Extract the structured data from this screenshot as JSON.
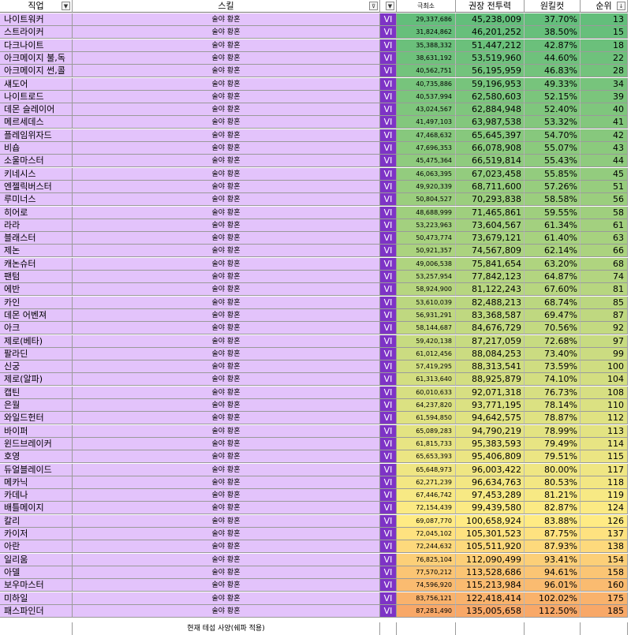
{
  "header": {
    "job": "직업",
    "skill": "스킬",
    "v": "",
    "min": "극최소",
    "cp": "권장 전투력",
    "pct": "원킬컷",
    "rank": "순위",
    "filter_icon": "dropdown-filter-icon",
    "sort_icon": "sort-filter-icon"
  },
  "colors": {
    "job_bg": "#e3c3fb",
    "v_bg": "#7e33c6",
    "gradient_low": "#63be7b",
    "gradient_mid": "#ffeb84",
    "gradient_high": "#f8a868"
  },
  "rows": [
    {
      "job": "나이트워커",
      "skill": "술야 황혼",
      "v": "VI",
      "min": "29,337,686",
      "cp": "45,238,009",
      "pct": "37.70%",
      "rank": "13"
    },
    {
      "job": "스트라이커",
      "skill": "술야 황혼",
      "v": "VI",
      "min": "31,824,862",
      "cp": "46,201,252",
      "pct": "38.50%",
      "rank": "15"
    },
    {
      "job": "다크나이트",
      "skill": "술야 황혼",
      "v": "VI",
      "min": "35,388,332",
      "cp": "51,447,212",
      "pct": "42.87%",
      "rank": "18"
    },
    {
      "job": "아크메이지 불,독",
      "skill": "술야 황혼",
      "v": "VI",
      "min": "38,631,192",
      "cp": "53,519,960",
      "pct": "44.60%",
      "rank": "22"
    },
    {
      "job": "아크메이지 썬,콜",
      "skill": "술야 황혼",
      "v": "VI",
      "min": "40,562,751",
      "cp": "56,195,959",
      "pct": "46.83%",
      "rank": "28"
    },
    {
      "job": "섀도어",
      "skill": "술야 황혼",
      "v": "VI",
      "min": "40,735,886",
      "cp": "59,196,953",
      "pct": "49.33%",
      "rank": "34"
    },
    {
      "job": "나이트로드",
      "skill": "술야 황혼",
      "v": "VI",
      "min": "40,537,994",
      "cp": "62,580,603",
      "pct": "52.15%",
      "rank": "39"
    },
    {
      "job": "데몬 슬레이어",
      "skill": "술야 황혼",
      "v": "VI",
      "min": "43,024,567",
      "cp": "62,884,948",
      "pct": "52.40%",
      "rank": "40"
    },
    {
      "job": "메르세데스",
      "skill": "술야 황혼",
      "v": "VI",
      "min": "41,497,103",
      "cp": "63,987,538",
      "pct": "53.32%",
      "rank": "41"
    },
    {
      "job": "플레임위자드",
      "skill": "술야 황혼",
      "v": "VI",
      "min": "47,468,632",
      "cp": "65,645,397",
      "pct": "54.70%",
      "rank": "42"
    },
    {
      "job": "비숍",
      "skill": "술야 황혼",
      "v": "VI",
      "min": "47,696,353",
      "cp": "66,078,908",
      "pct": "55.07%",
      "rank": "43"
    },
    {
      "job": "소울마스터",
      "skill": "술야 황혼",
      "v": "VI",
      "min": "45,475,364",
      "cp": "66,519,814",
      "pct": "55.43%",
      "rank": "44"
    },
    {
      "job": "키네시스",
      "skill": "술야 황혼",
      "v": "VI",
      "min": "46,063,395",
      "cp": "67,023,458",
      "pct": "55.85%",
      "rank": "45"
    },
    {
      "job": "엔젤릭버스터",
      "skill": "술야 황혼",
      "v": "VI",
      "min": "49,920,339",
      "cp": "68,711,600",
      "pct": "57.26%",
      "rank": "51"
    },
    {
      "job": "루미너스",
      "skill": "술야 황혼",
      "v": "VI",
      "min": "50,804,527",
      "cp": "70,293,838",
      "pct": "58.58%",
      "rank": "56"
    },
    {
      "job": "히어로",
      "skill": "술야 황혼",
      "v": "VI",
      "min": "48,688,999",
      "cp": "71,465,861",
      "pct": "59.55%",
      "rank": "58"
    },
    {
      "job": "라라",
      "skill": "술야 황혼",
      "v": "VI",
      "min": "53,223,963",
      "cp": "73,604,567",
      "pct": "61.34%",
      "rank": "61"
    },
    {
      "job": "블래스터",
      "skill": "술야 황혼",
      "v": "VI",
      "min": "50,473,774",
      "cp": "73,679,121",
      "pct": "61.40%",
      "rank": "63"
    },
    {
      "job": "제논",
      "skill": "술야 황혼",
      "v": "VI",
      "min": "50,921,357",
      "cp": "74,567,809",
      "pct": "62.14%",
      "rank": "66"
    },
    {
      "job": "캐논슈터",
      "skill": "술야 황혼",
      "v": "VI",
      "min": "49,006,538",
      "cp": "75,841,654",
      "pct": "63.20%",
      "rank": "68"
    },
    {
      "job": "팬텀",
      "skill": "술야 황혼",
      "v": "VI",
      "min": "53,257,954",
      "cp": "77,842,123",
      "pct": "64.87%",
      "rank": "74"
    },
    {
      "job": "에반",
      "skill": "술야 황혼",
      "v": "VI",
      "min": "58,924,900",
      "cp": "81,122,243",
      "pct": "67.60%",
      "rank": "81"
    },
    {
      "job": "카인",
      "skill": "술야 황혼",
      "v": "VI",
      "min": "53,610,039",
      "cp": "82,488,213",
      "pct": "68.74%",
      "rank": "85"
    },
    {
      "job": "데몬 어벤져",
      "skill": "술야 황혼",
      "v": "VI",
      "min": "56,931,291",
      "cp": "83,368,587",
      "pct": "69.47%",
      "rank": "87"
    },
    {
      "job": "아크",
      "skill": "술야 황혼",
      "v": "VI",
      "min": "58,144,687",
      "cp": "84,676,729",
      "pct": "70.56%",
      "rank": "92"
    },
    {
      "job": "제로(베타)",
      "skill": "술야 황혼",
      "v": "VI",
      "min": "59,420,138",
      "cp": "87,217,059",
      "pct": "72.68%",
      "rank": "97"
    },
    {
      "job": "팔라딘",
      "skill": "술야 황혼",
      "v": "VI",
      "min": "61,012,456",
      "cp": "88,084,253",
      "pct": "73.40%",
      "rank": "99"
    },
    {
      "job": "신궁",
      "skill": "술야 황혼",
      "v": "VI",
      "min": "57,419,295",
      "cp": "88,313,541",
      "pct": "73.59%",
      "rank": "100"
    },
    {
      "job": "제로(알파)",
      "skill": "술야 황혼",
      "v": "VI",
      "min": "61,313,640",
      "cp": "88,925,879",
      "pct": "74.10%",
      "rank": "104"
    },
    {
      "job": "캡틴",
      "skill": "술야 황혼",
      "v": "VI",
      "min": "60,010,633",
      "cp": "92,071,318",
      "pct": "76.73%",
      "rank": "108"
    },
    {
      "job": "은월",
      "skill": "술야 황혼",
      "v": "VI",
      "min": "64,237,820",
      "cp": "93,771,195",
      "pct": "78.14%",
      "rank": "110"
    },
    {
      "job": "와일드헌터",
      "skill": "술야 황혼",
      "v": "VI",
      "min": "61,594,850",
      "cp": "94,642,575",
      "pct": "78.87%",
      "rank": "112"
    },
    {
      "job": "바이퍼",
      "skill": "술야 황혼",
      "v": "VI",
      "min": "65,089,283",
      "cp": "94,790,219",
      "pct": "78.99%",
      "rank": "113"
    },
    {
      "job": "윈드브레이커",
      "skill": "술야 황혼",
      "v": "VI",
      "min": "61,815,733",
      "cp": "95,383,593",
      "pct": "79.49%",
      "rank": "114"
    },
    {
      "job": "호영",
      "skill": "술야 황혼",
      "v": "VI",
      "min": "65,653,393",
      "cp": "95,406,809",
      "pct": "79.51%",
      "rank": "115"
    },
    {
      "job": "듀얼블레이드",
      "skill": "술야 황혼",
      "v": "VI",
      "min": "65,648,973",
      "cp": "96,003,422",
      "pct": "80.00%",
      "rank": "117"
    },
    {
      "job": "메카닉",
      "skill": "술야 황혼",
      "v": "VI",
      "min": "62,271,239",
      "cp": "96,634,763",
      "pct": "80.53%",
      "rank": "118"
    },
    {
      "job": "카데나",
      "skill": "술야 황혼",
      "v": "VI",
      "min": "67,446,742",
      "cp": "97,453,289",
      "pct": "81.21%",
      "rank": "119"
    },
    {
      "job": "배틀메이지",
      "skill": "술야 황혼",
      "v": "VI",
      "min": "72,154,439",
      "cp": "99,439,580",
      "pct": "82.87%",
      "rank": "124"
    },
    {
      "job": "칼리",
      "skill": "술야 황혼",
      "v": "VI",
      "min": "69,087,770",
      "cp": "100,658,924",
      "pct": "83.88%",
      "rank": "126"
    },
    {
      "job": "카이저",
      "skill": "술야 황혼",
      "v": "VI",
      "min": "72,045,102",
      "cp": "105,301,523",
      "pct": "87.75%",
      "rank": "137"
    },
    {
      "job": "아란",
      "skill": "술야 황혼",
      "v": "VI",
      "min": "72,244,632",
      "cp": "105,511,920",
      "pct": "87.93%",
      "rank": "138"
    },
    {
      "job": "일리움",
      "skill": "술야 황혼",
      "v": "VI",
      "min": "76,825,104",
      "cp": "112,090,499",
      "pct": "93.41%",
      "rank": "154"
    },
    {
      "job": "아델",
      "skill": "술야 황혼",
      "v": "VI",
      "min": "77,570,212",
      "cp": "113,528,686",
      "pct": "94.61%",
      "rank": "158"
    },
    {
      "job": "보우마스터",
      "skill": "술야 황혼",
      "v": "VI",
      "min": "74,596,920",
      "cp": "115,213,984",
      "pct": "96.01%",
      "rank": "160"
    },
    {
      "job": "미하일",
      "skill": "술야 황혼",
      "v": "VI",
      "min": "83,756,121",
      "cp": "122,418,414",
      "pct": "102.02%",
      "rank": "175"
    },
    {
      "job": "패스파인더",
      "skill": "술야 황혼",
      "v": "VI",
      "min": "87,281,490",
      "cp": "135,005,658",
      "pct": "112.50%",
      "rank": "185"
    }
  ],
  "footer": {
    "note": "현재 테섭 사양(쉐파 적용)"
  }
}
